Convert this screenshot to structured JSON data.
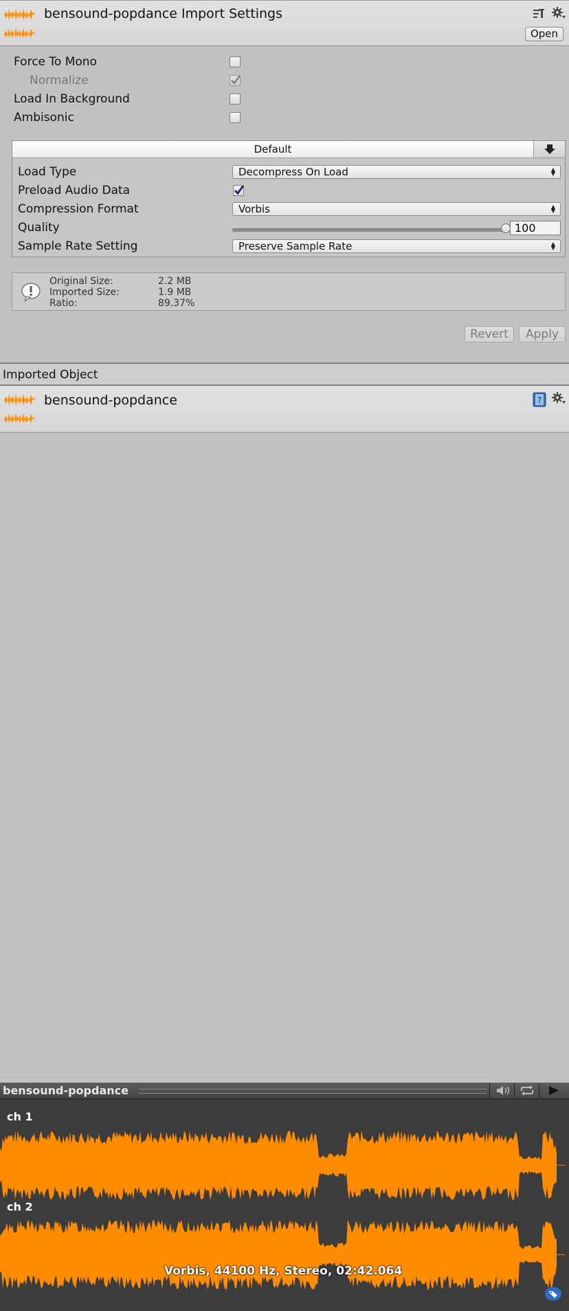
{
  "header": {
    "title": "bensound-popdance Import Settings",
    "open_label": "Open",
    "icons": [
      "audio-clip-icon",
      "preset-icon",
      "gear-icon"
    ]
  },
  "toggles": [
    {
      "label": "Force To Mono",
      "checked": false,
      "dim": false
    },
    {
      "label": "Normalize",
      "checked": true,
      "dim": true
    },
    {
      "label": "Load In Background",
      "checked": false,
      "dim": false
    },
    {
      "label": "Ambisonic",
      "checked": false,
      "dim": false
    }
  ],
  "platform": {
    "tab_label": "Default",
    "load_type_label": "Load Type",
    "load_type_value": "Decompress On Load",
    "preload_label": "Preload Audio Data",
    "preload_checked": true,
    "compression_label": "Compression Format",
    "compression_value": "Vorbis",
    "quality_label": "Quality",
    "quality_value": "100",
    "quality_fraction": 1.0,
    "sample_rate_label": "Sample Rate Setting",
    "sample_rate_value": "Preserve Sample Rate"
  },
  "info": {
    "original_size_label": "Original Size:",
    "original_size_value": "2.2 MB",
    "imported_size_label": "Imported Size:",
    "imported_size_value": "1.9 MB",
    "ratio_label": "Ratio:",
    "ratio_value": "89.37%"
  },
  "actions": {
    "revert_label": "Revert",
    "apply_label": "Apply"
  },
  "imported_object": {
    "section_label": "Imported Object",
    "name": "bensound-popdance"
  },
  "preview": {
    "title": "bensound-popdance",
    "channel1": "ch 1",
    "channel2": "ch 2",
    "caption": "Vorbis, 44100 Hz, Stereo, 02:42.064",
    "waveform_color": "#ff8c00"
  },
  "colors": {
    "background": "#c2c2c2",
    "accent": "#ff8c00"
  }
}
